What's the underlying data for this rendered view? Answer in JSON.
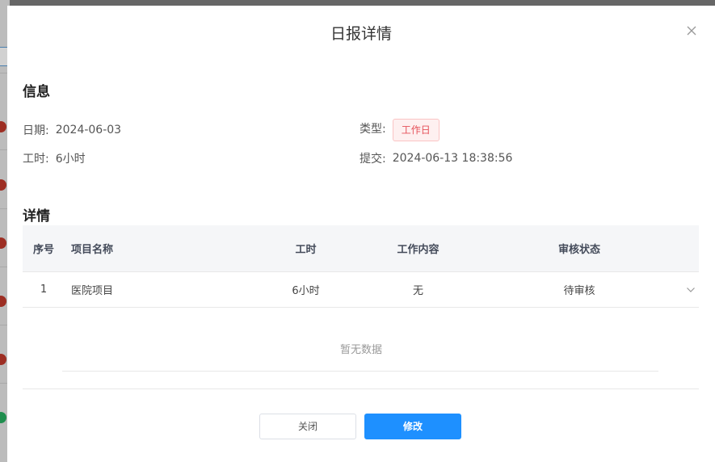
{
  "modal": {
    "title": "日报详情"
  },
  "info_section": {
    "title": "信息",
    "date_label": "日期:",
    "date_value": "2024-06-03",
    "type_label": "类型:",
    "type_tag": "工作日",
    "hours_label": "工时:",
    "hours_value": "6小时",
    "submit_label": "提交:",
    "submit_value": "2024-06-13 18:38:56"
  },
  "details_section": {
    "title": "详情",
    "columns": [
      "序号",
      "项目名称",
      "工时",
      "工作内容",
      "审核状态"
    ],
    "rows": [
      {
        "index": "1",
        "project": "医院项目",
        "hours": "6小时",
        "content": "无",
        "status": "待审核"
      }
    ],
    "empty_text": "暂无数据"
  },
  "footer": {
    "close_label": "关闭",
    "edit_label": "修改"
  },
  "colors": {
    "primary": "#1e90ff",
    "tag_text": "#e6515a",
    "tag_bg": "#fef0f0"
  },
  "icons": {
    "close": "close-icon",
    "expand": "chevron-down-icon"
  }
}
